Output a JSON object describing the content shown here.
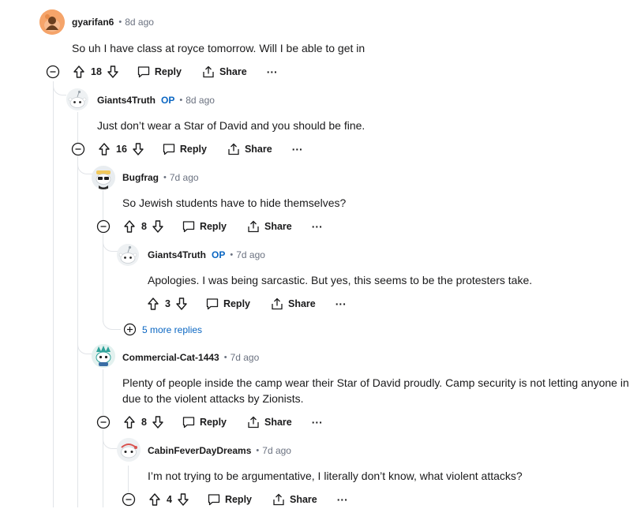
{
  "comments": [
    {
      "id": "c1",
      "author": "gyarifan6",
      "op": "",
      "time": "8d ago",
      "body": "So uh I have class at royce tomorrow. Will I be able to get in",
      "votes": "18"
    },
    {
      "id": "c2",
      "author": "Giants4Truth",
      "op": "OP",
      "time": "8d ago",
      "body": "Just don’t wear a Star of David and you should be fine.",
      "votes": "16"
    },
    {
      "id": "c3",
      "author": "Bugfrag",
      "op": "",
      "time": "7d ago",
      "body": "So Jewish students have to hide themselves?",
      "votes": "8"
    },
    {
      "id": "c4",
      "author": "Giants4Truth",
      "op": "OP",
      "time": "7d ago",
      "body": "Apologies. I was being sarcastic. But yes, this seems to be the protesters take.",
      "votes": "3"
    },
    {
      "id": "c5",
      "author": "Commercial-Cat-1443",
      "op": "",
      "time": "7d ago",
      "body_lines": [
        "Plenty of people inside the camp wear their Star of David proudly. Camp security is not letting anyone in",
        "due to the violent attacks by Zionists."
      ],
      "votes": "8"
    },
    {
      "id": "c6",
      "author": "CabinFeverDayDreams",
      "op": "",
      "time": "7d ago",
      "body": "I’m not trying to be argumentative, I literally don’t know, what violent attacks?",
      "votes": "4"
    }
  ],
  "actions": {
    "reply": "Reply",
    "share": "Share",
    "more": "···"
  },
  "more_replies": "5 more replies",
  "colors": {
    "accent": "#0a66c2",
    "thread_line": "#e1e4e8",
    "meta": "#6b7280"
  }
}
